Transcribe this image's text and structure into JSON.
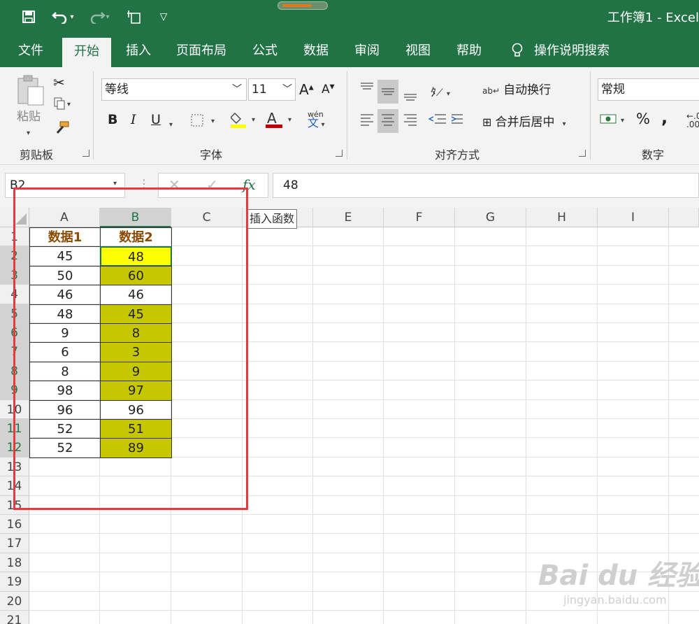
{
  "titlebar": {
    "title": "工作簿1  -  Excel"
  },
  "tabs": [
    {
      "label": "文件"
    },
    {
      "label": "开始"
    },
    {
      "label": "插入"
    },
    {
      "label": "页面布局"
    },
    {
      "label": "公式"
    },
    {
      "label": "数据"
    },
    {
      "label": "审阅"
    },
    {
      "label": "视图"
    },
    {
      "label": "帮助"
    },
    {
      "label": "操作说明搜索"
    }
  ],
  "ribbon": {
    "clipboard": {
      "label": "剪贴板",
      "paste_label": "粘贴"
    },
    "font": {
      "label": "字体",
      "font_name": "等线",
      "font_size": "11",
      "bold": "B",
      "italic": "I",
      "underline": "U",
      "font_color_glyph": "A",
      "grow": "A",
      "shrink": "A",
      "phonetic": "wén 文"
    },
    "alignment": {
      "label": "对齐方式",
      "wrap_text": "自动换行",
      "merge_center": "合并后居中"
    },
    "number": {
      "label": "数字",
      "format": "常规",
      "percent": "%",
      "comma": ","
    }
  },
  "formula_bar": {
    "name_box": "B2",
    "fx": "fx",
    "value": "48",
    "tooltip": "插入函数"
  },
  "grid": {
    "columns": [
      "A",
      "B",
      "C",
      "D",
      "E",
      "F",
      "G",
      "H",
      "I"
    ],
    "rows": [
      "1",
      "2",
      "3",
      "4",
      "5",
      "6",
      "7",
      "8",
      "9",
      "10",
      "11",
      "12",
      "13",
      "14",
      "15",
      "16",
      "17",
      "18",
      "19",
      "20",
      "21"
    ],
    "selected_column": "B",
    "active_cell": "B2",
    "headers": {
      "a": "数据1",
      "b": "数据2"
    },
    "data": [
      {
        "a": "45",
        "b": "48"
      },
      {
        "a": "50",
        "b": "60"
      },
      {
        "a": "46",
        "b": "46"
      },
      {
        "a": "48",
        "b": "45"
      },
      {
        "a": "9",
        "b": "8"
      },
      {
        "a": "6",
        "b": "3"
      },
      {
        "a": "8",
        "b": "9"
      },
      {
        "a": "98",
        "b": "97"
      },
      {
        "a": "96",
        "b": "96"
      },
      {
        "a": "52",
        "b": "51"
      },
      {
        "a": "52",
        "b": "89"
      }
    ],
    "highlighted_rows_b": [
      2,
      3,
      5,
      6,
      7,
      8,
      9,
      11,
      12
    ]
  },
  "colors": {
    "excel_green": "#217346",
    "highlight": "#c7c700",
    "active_fill": "#ffff00",
    "annotation_red": "#e8393f",
    "header_text": "#8a4a00"
  },
  "watermark": {
    "brand": "Bai du 经验",
    "url": "jingyan.baidu.com"
  }
}
